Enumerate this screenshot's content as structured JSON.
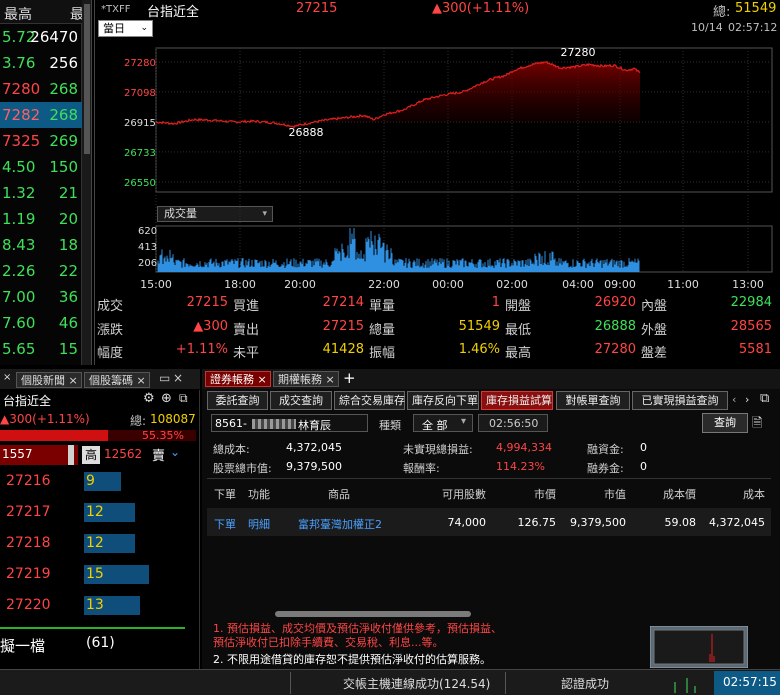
{
  "left_quotes": {
    "header": {
      "col1": "最高",
      "col2": "最"
    },
    "rows": [
      {
        "price": "5.72",
        "vol": "26470",
        "price_color": "green",
        "vol_color": "white",
        "highlight": false
      },
      {
        "price": "3.76",
        "vol": "256",
        "price_color": "green",
        "vol_color": "white",
        "highlight": false
      },
      {
        "price": "7280",
        "vol": "268",
        "price_color": "red",
        "vol_color": "green",
        "highlight": false
      },
      {
        "price": "7282",
        "vol": "268",
        "price_color": "red",
        "vol_color": "green",
        "highlight": true
      },
      {
        "price": "7325",
        "vol": "269",
        "price_color": "red",
        "vol_color": "green",
        "highlight": false
      },
      {
        "price": "4.50",
        "vol": "150",
        "price_color": "green",
        "vol_color": "green",
        "highlight": false
      },
      {
        "price": "1.32",
        "vol": "21",
        "price_color": "green",
        "vol_color": "green",
        "highlight": false
      },
      {
        "price": "1.19",
        "vol": "20",
        "price_color": "green",
        "vol_color": "green",
        "highlight": false
      },
      {
        "price": "8.43",
        "vol": "18",
        "price_color": "green",
        "vol_color": "green",
        "highlight": false
      },
      {
        "price": "2.26",
        "vol": "22",
        "price_color": "green",
        "vol_color": "green",
        "highlight": false
      },
      {
        "price": "7.00",
        "vol": "36",
        "price_color": "green",
        "vol_color": "green",
        "highlight": false
      },
      {
        "price": "7.60",
        "vol": "46",
        "price_color": "green",
        "vol_color": "green",
        "highlight": false
      },
      {
        "price": "5.65",
        "vol": "15",
        "price_color": "green",
        "vol_color": "green",
        "highlight": false
      }
    ]
  },
  "chart": {
    "symbol": "*TXFF",
    "name": "台指近全",
    "price": "27215",
    "change": "▲300(+1.11%)",
    "total_label": "總:",
    "total_value": "51549",
    "date": "10/14",
    "time": "02:57:12",
    "period": "當日",
    "volume_select": "成交量",
    "y_ticks": [
      "27280",
      "27098",
      "26915",
      "26733",
      "26550"
    ],
    "vol_ticks": [
      "620",
      "413",
      "206"
    ],
    "x_ticks": [
      "15:00",
      "18:00",
      "20:00",
      "22:00",
      "00:00",
      "02:00",
      "04:00",
      "09:00",
      "11:00",
      "13:00"
    ],
    "high_annotation": "27280",
    "low_annotation": "26888",
    "colors": {
      "price_line": "#e02020",
      "area_fill": "#7a0000",
      "volume": "#2f8fe0",
      "grid": "#2e2e2e"
    }
  },
  "stats": [
    {
      "label": "成交",
      "value": "27215",
      "color": "red"
    },
    {
      "label": "買進",
      "value": "27214",
      "color": "red"
    },
    {
      "label": "單量",
      "value": "1",
      "color": "red"
    },
    {
      "label": "開盤",
      "value": "26920",
      "color": "red"
    },
    {
      "label": "內盤",
      "value": "22984",
      "color": "green"
    },
    {
      "label": "漲跌",
      "value": "▲300",
      "color": "red"
    },
    {
      "label": "賣出",
      "value": "27215",
      "color": "red"
    },
    {
      "label": "總量",
      "value": "51549",
      "color": "yellow"
    },
    {
      "label": "最低",
      "value": "26888",
      "color": "green"
    },
    {
      "label": "外盤",
      "value": "28565",
      "color": "red"
    },
    {
      "label": "幅度",
      "value": "+1.11%",
      "color": "red"
    },
    {
      "label": "未平",
      "value": "41428",
      "color": "yellow"
    },
    {
      "label": "振幅",
      "value": "1.46%",
      "color": "yellow"
    },
    {
      "label": "最高",
      "value": "27280",
      "color": "red"
    },
    {
      "label": "盤差",
      "value": "5581",
      "color": "red"
    }
  ],
  "bottom_left": {
    "tabs": [
      "個股新聞",
      "個股籌碼"
    ],
    "name": "台指近全",
    "change": "▲300(+1.11%)",
    "total_label": "總:",
    "total_value": "108087",
    "pct": "55.35%",
    "left_value": "1557",
    "hi_label": "高",
    "hi_value": "12562",
    "sell_label": "賣",
    "order_book": [
      {
        "price": "27216",
        "qty": "9",
        "bar": 0.22
      },
      {
        "price": "27217",
        "qty": "12",
        "bar": 0.3
      },
      {
        "price": "27218",
        "qty": "12",
        "bar": 0.3
      },
      {
        "price": "27219",
        "qty": "15",
        "bar": 0.38
      },
      {
        "price": "27220",
        "qty": "13",
        "bar": 0.33
      }
    ],
    "footer_label": "擬一檔",
    "footer_value": "(61)"
  },
  "account": {
    "top_tabs": [
      "證券帳務",
      "期權帳務"
    ],
    "add_label": "+",
    "sub_tabs": [
      "委託查詢",
      "成交查詢",
      "綜合交易庫存",
      "庫存反向下單",
      "庫存損益試算",
      "對帳單查詢",
      "已實現損益查詢"
    ],
    "active_sub_tab": 4,
    "account_id": "8561-",
    "account_name": "林育辰",
    "type_label": "種類",
    "type_value": "全  部",
    "time": "02:56:50",
    "query_button": "查詢",
    "summary": {
      "cost_label": "總成本:",
      "cost_value": "4,372,045",
      "unrealized_label": "未實現總損益:",
      "unrealized_value": "4,994,334",
      "margin_label": "融資金:",
      "margin_value": "0",
      "market_label": "股票總市值:",
      "market_value": "9,379,500",
      "return_label": "報酬率:",
      "return_value": "114.23%",
      "short_label": "融券金:",
      "short_value": "0"
    },
    "columns": [
      "下單",
      "功能",
      "商品",
      "可用股數",
      "市價",
      "市值",
      "成本價",
      "成本"
    ],
    "rows": [
      {
        "order": "下單",
        "func": "明細",
        "product": "富邦臺灣加權正2",
        "shares": "74,000",
        "price": "126.75",
        "value": "9,379,500",
        "cost_price": "59.08",
        "cost": "4,372,045"
      }
    ],
    "notes": [
      "1. 預估損益、成交均價及預估淨收付僅供參考，預估損益、",
      "預估淨收付已扣除手續費、交易稅、利息...等。",
      "2. 不限用途借貸的庫存恕不提供預估淨收付的估算服務。"
    ]
  },
  "statusbar": {
    "connection": "交帳主機連線成功(124.54)",
    "login": "認證成功",
    "time": "02:57:15"
  }
}
